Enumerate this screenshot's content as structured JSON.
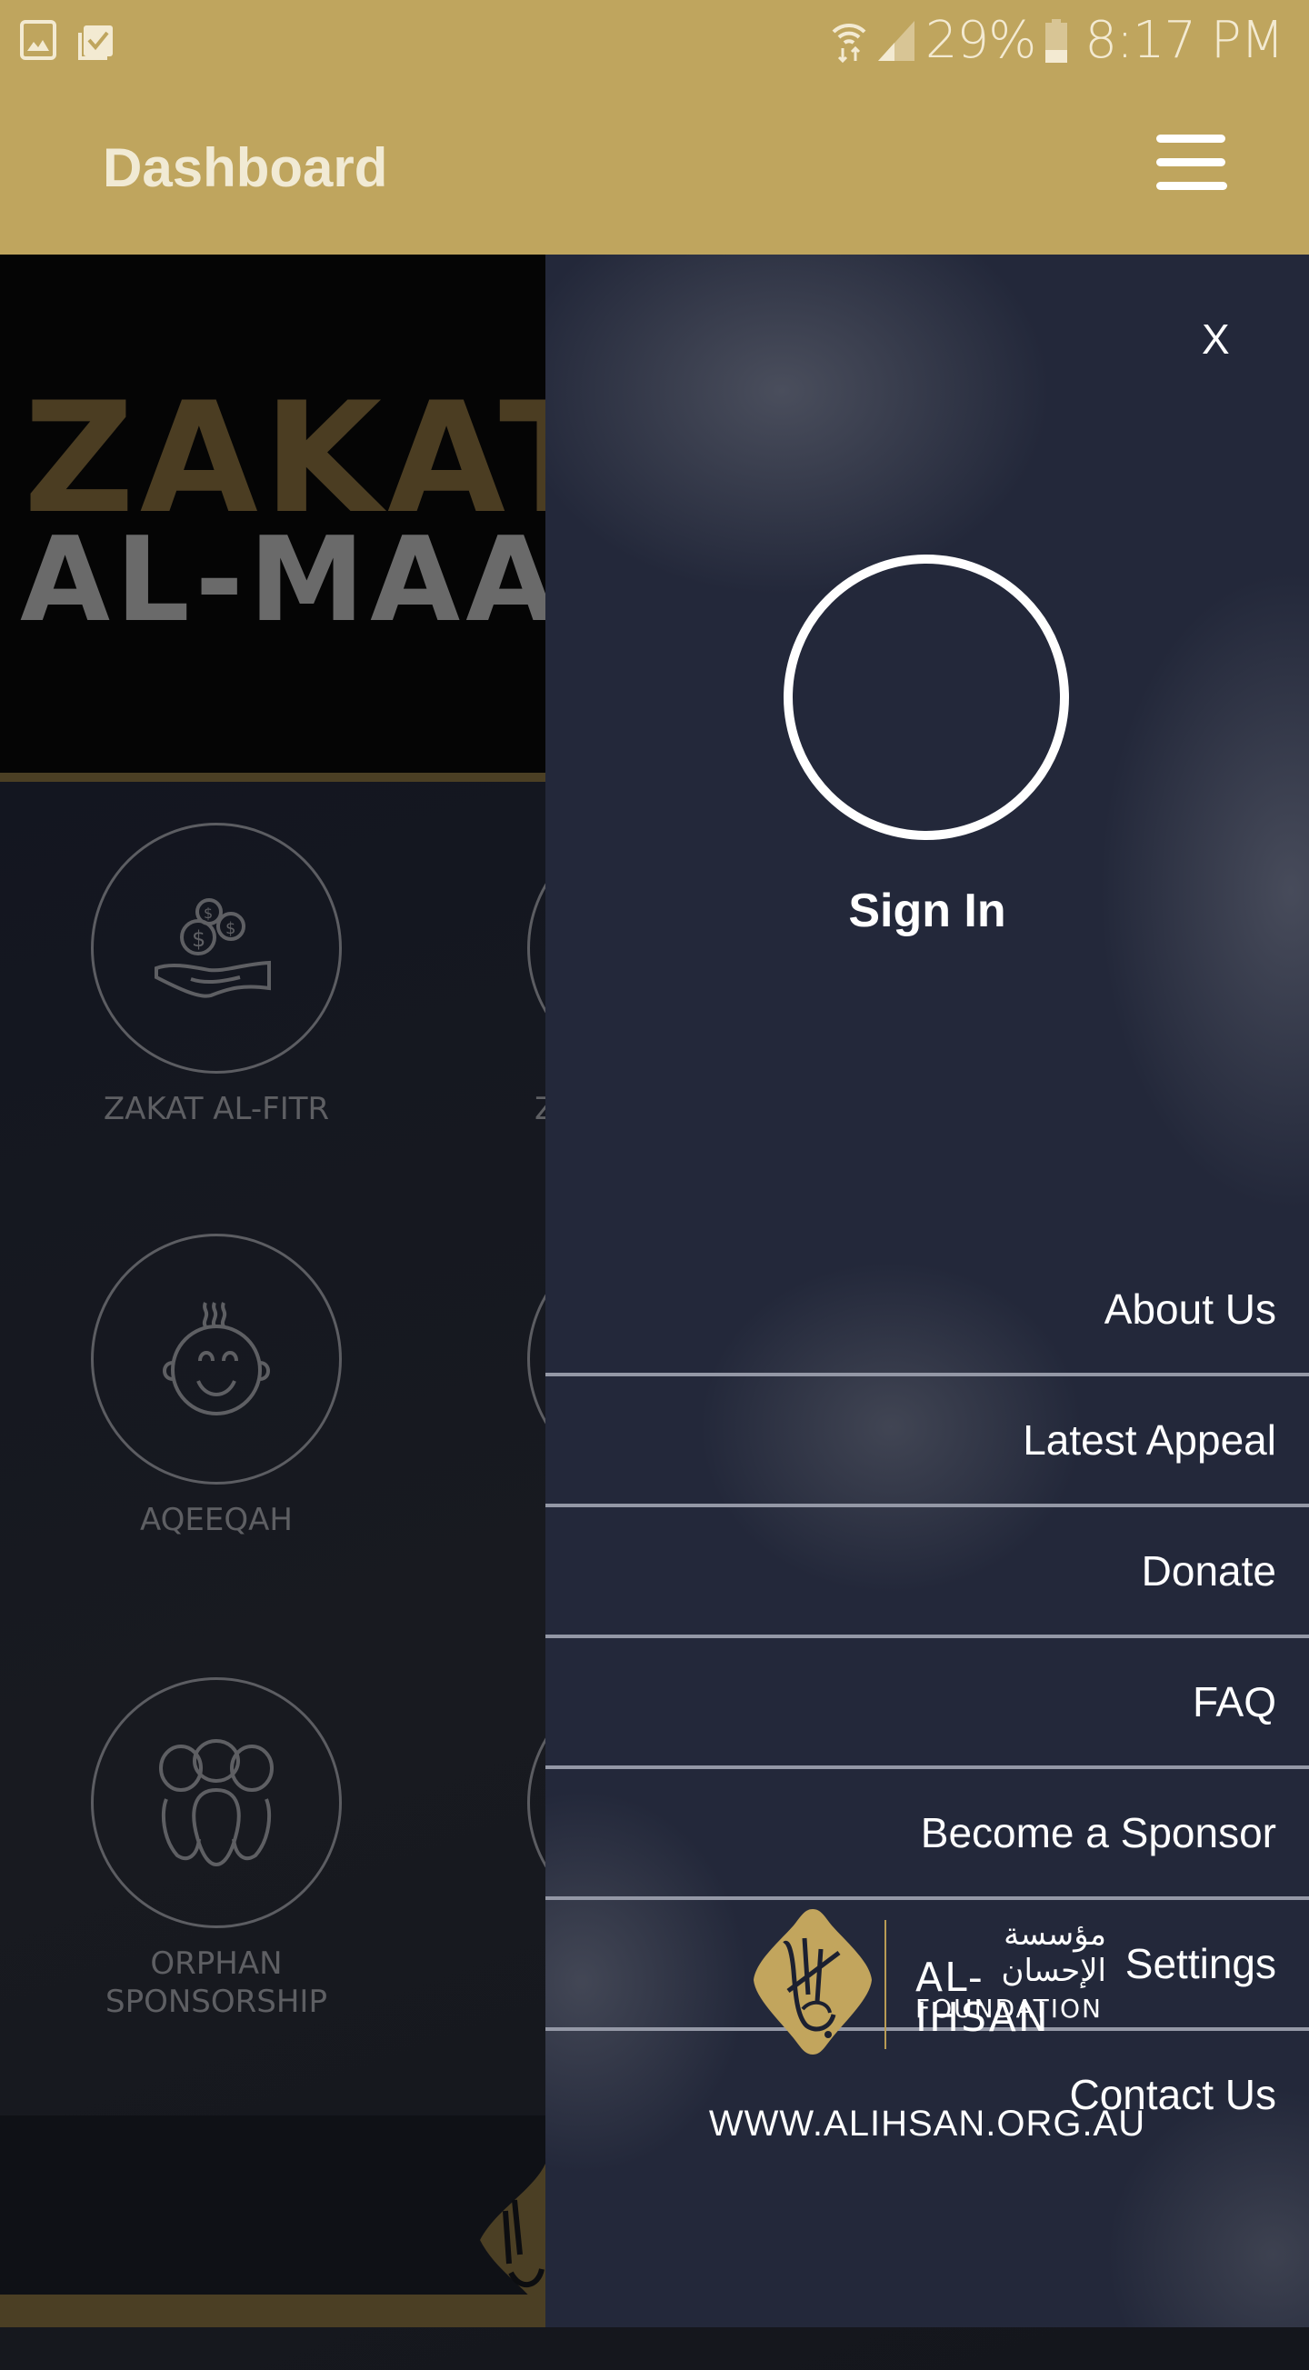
{
  "status_bar": {
    "left_icons": [
      "gallery-icon",
      "clipboard-check-icon"
    ],
    "right_icons": [
      "wifi-icon",
      "signal-icon",
      "battery-icon"
    ],
    "battery": "29%",
    "time": "8:17 PM"
  },
  "app_bar": {
    "title": "Dashboard",
    "menu_icon": "hamburger-icon"
  },
  "background": {
    "banner": {
      "line1": "ZAKAT",
      "line2": "AL-MAAL"
    },
    "tiles": [
      {
        "label": "ZAKAT AL-FITR",
        "icon": "hand-coins-icon"
      },
      {
        "label": "Z",
        "icon": "circle-icon"
      },
      {
        "label": "AQEEQAH",
        "icon": "baby-face-icon"
      },
      {
        "label": "",
        "icon": "circle-icon"
      },
      {
        "label": "ORPHAN SPONSORSHIP",
        "label_line1": "ORPHAN",
        "label_line2": "SPONSORSHIP",
        "icon": "group-people-icon"
      },
      {
        "label": "",
        "icon": "circle-icon"
      }
    ]
  },
  "drawer": {
    "close_label": "X",
    "sign_in_label": "Sign In",
    "menu_items": [
      {
        "label": "About Us"
      },
      {
        "label": "Latest Appeal"
      },
      {
        "label": "Donate"
      },
      {
        "label": "FAQ"
      },
      {
        "label": "Become a Sponsor"
      },
      {
        "label": "Settings"
      },
      {
        "label": "Contact Us"
      }
    ],
    "logo": {
      "arabic": "مؤسسة الإحسان",
      "name": "AL-IHSAN",
      "subtitle": "FOUNDATION"
    },
    "website": "WWW.ALIHSAN.ORG.AU"
  },
  "colors": {
    "header_gold": "#bfa55e",
    "drawer_bg": "#23283a",
    "divider": "#9498a6",
    "logo_gold": "#c2a55d"
  }
}
